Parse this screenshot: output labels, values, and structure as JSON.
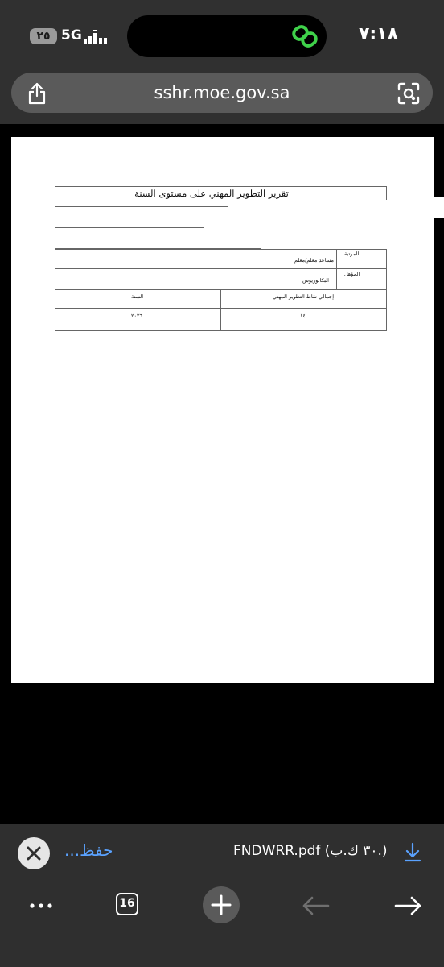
{
  "status_bar": {
    "battery": "٢٥",
    "network": "5G",
    "clock": "٧:١٨",
    "icons": [
      "signal-icon",
      "link-icon"
    ]
  },
  "address_bar": {
    "url": "sshr.moe.gov.sa",
    "icons": [
      "share-icon",
      "lens-icon"
    ]
  },
  "report": {
    "title": "تقرير التطوير المهني على مستوى السنة",
    "rank_label": "المرتبة",
    "rank_value": "مساعد معلم/معلم",
    "qualification_label": "المؤهل",
    "qualification_value": "البكالوريوس",
    "total_points_header": "إجمالي نقاط التطوير المهني",
    "year_header": "السنة",
    "total_points_value": "١٤",
    "year_value": "٢٠٢٦"
  },
  "download_bar": {
    "save_label": "حفظ...",
    "file_label": "FNDWRR.pdf (٣٠ ك.ب.)",
    "icons": [
      "close-icon",
      "download-icon"
    ]
  },
  "bottom_bar": {
    "tab_count": "16",
    "icons": [
      "more-icon",
      "tabs-icon",
      "plus-icon",
      "back-arrow-icon",
      "forward-arrow-icon"
    ]
  },
  "colors": {
    "chrome_bg": "#303030",
    "address_bg": "#5a5a5a",
    "link_green": "#3fd14a",
    "link_blue": "#5aa2ff"
  }
}
